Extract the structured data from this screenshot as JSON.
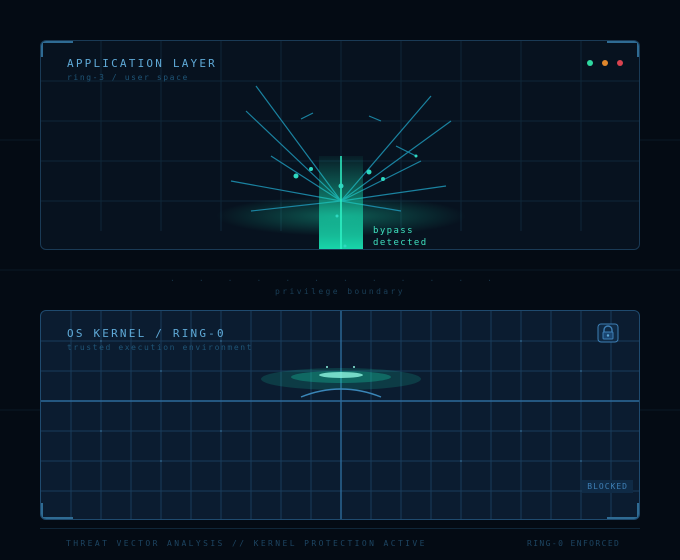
{
  "app_layer": {
    "title": "APPLICATION LAYER",
    "subtitle": "ring-3 / user space",
    "status_dots": [
      {
        "name": "green-status-dot",
        "color": "#2fd8a0"
      },
      {
        "name": "orange-status-dot",
        "color": "#e0872c"
      },
      {
        "name": "red-status-dot",
        "color": "#d9434f"
      }
    ],
    "alert_line1": "bypass",
    "alert_line2": "detected"
  },
  "boundary": {
    "label": "privilege boundary"
  },
  "kernel_layer": {
    "title": "OS KERNEL / RING-0",
    "subtitle": "trusted execution environment",
    "lock_icon": "lock-icon",
    "status_badge": "BLOCKED"
  },
  "footer": {
    "left": "THREAT VECTOR ANALYSIS // KERNEL PROTECTION ACTIVE",
    "right": "RING-0 ENFORCED"
  },
  "colors": {
    "accent_teal": "#19e3b4",
    "accent_blue": "#5fa9d6",
    "background": "#040b14"
  }
}
